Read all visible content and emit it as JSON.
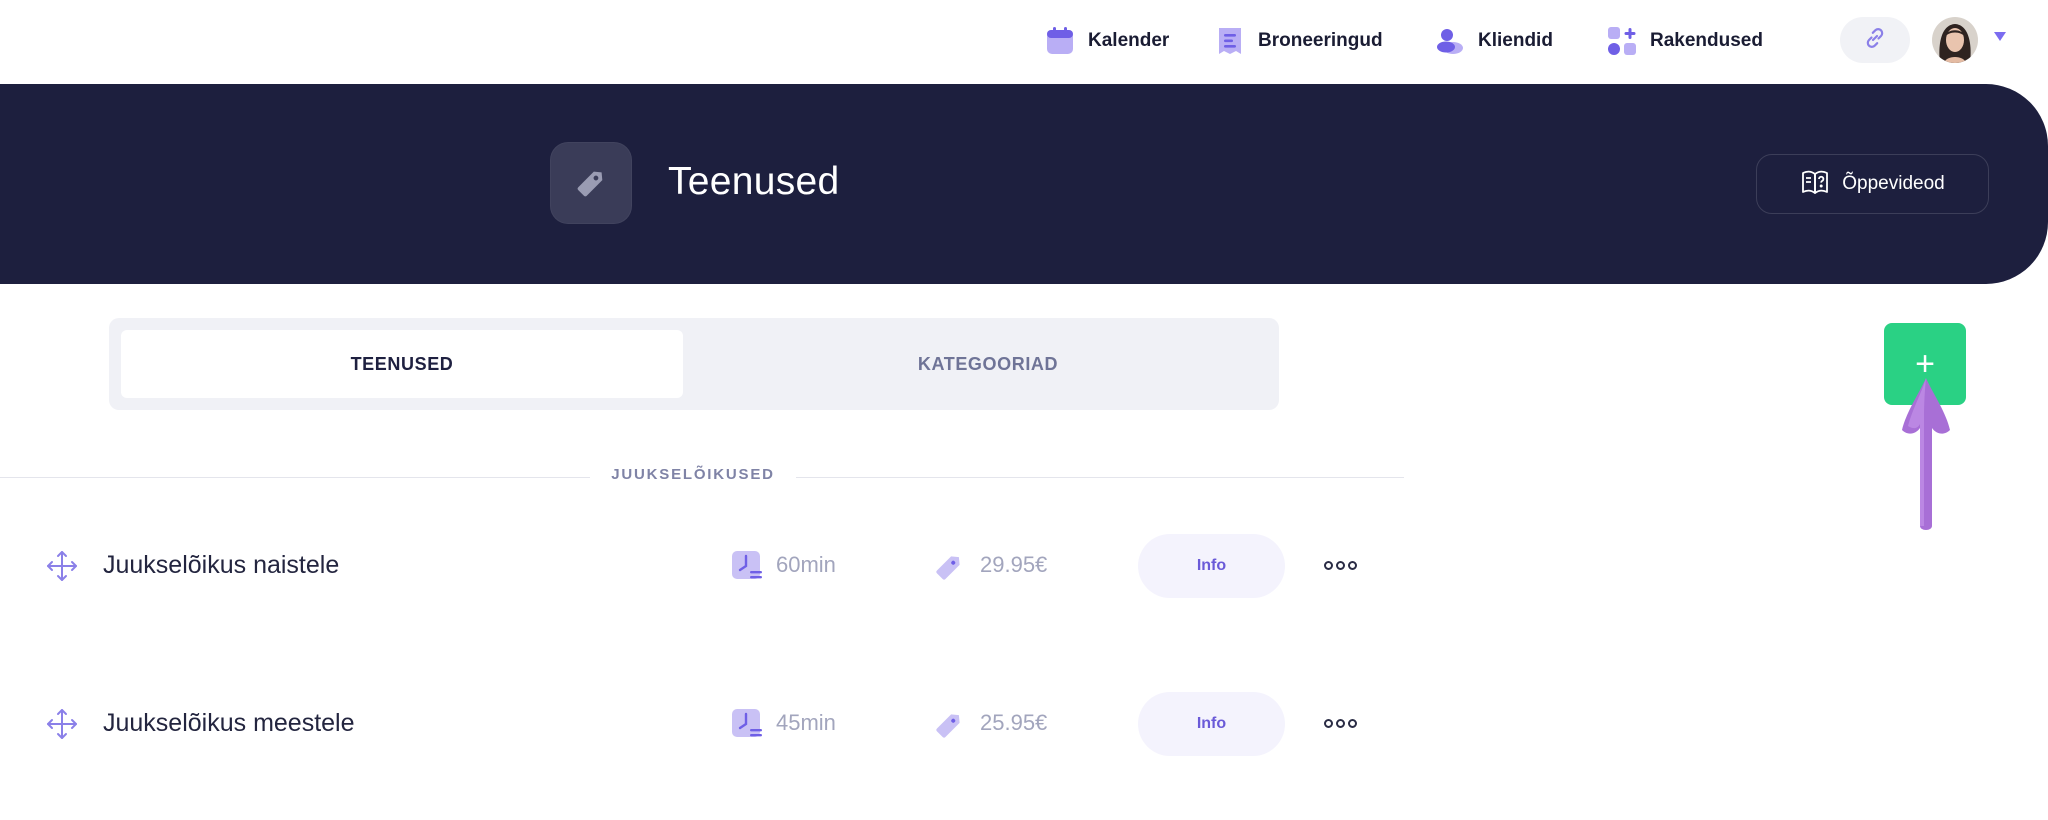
{
  "nav": {
    "items": [
      {
        "label": "Kalender",
        "icon": "calendar-icon"
      },
      {
        "label": "Broneeringud",
        "icon": "bookings-icon"
      },
      {
        "label": "Kliendid",
        "icon": "clients-icon"
      },
      {
        "label": "Rakendused",
        "icon": "apps-icon"
      }
    ],
    "link_icon": "link-icon",
    "avatar_icon": "avatar",
    "menu_icon": "chevron-down-icon"
  },
  "header": {
    "title": "Teenused",
    "icon": "tag-icon",
    "videos_label": "Õppevideod",
    "videos_icon": "book-question-icon"
  },
  "tabs": {
    "active": "TEENUSED",
    "inactive": "KATEGOORIAD"
  },
  "add_button": {
    "label": "+"
  },
  "section": {
    "label": "JUUKSELÕIKUSED"
  },
  "services": [
    {
      "name": "Juukselõikus naistele",
      "duration": "60min",
      "price": "29.95€",
      "info_label": "Info"
    },
    {
      "name": "Juukselõikus meestele",
      "duration": "45min",
      "price": "25.95€",
      "info_label": "Info"
    }
  ],
  "colors": {
    "banner": "#1d1f3e",
    "accent": "#7b6cf0",
    "add_button": "#2ad184",
    "hint_arrow": "#a86fd6"
  }
}
